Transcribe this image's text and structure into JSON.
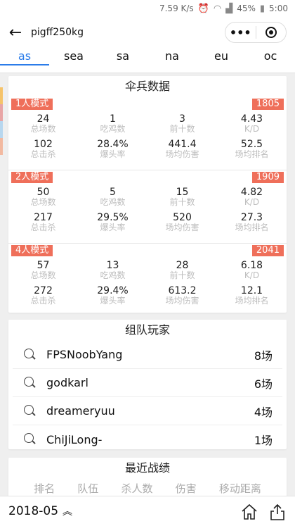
{
  "statusbar": {
    "speed": "7.59 K/s",
    "battery": "45%",
    "time": "5:00"
  },
  "navbar": {
    "title": "pigff250kg",
    "more_icon": "•••"
  },
  "tabs": [
    "as",
    "sea",
    "sa",
    "na",
    "eu",
    "oc"
  ],
  "side_tag_colors": [
    "#f5c36a",
    "#e8a5a5",
    "#b7d7ef",
    "#f2b9a0"
  ],
  "infantry": {
    "title": "伞兵数据",
    "labels": [
      "总场数",
      "吃鸡数",
      "前十数",
      "K/D",
      "总击杀",
      "爆头率",
      "场均伤害",
      "场均排名"
    ],
    "modes": [
      {
        "name": "1人模式",
        "rating": "1805",
        "values": [
          "24",
          "1",
          "3",
          "4.43",
          "102",
          "28.4%",
          "441.4",
          "52.5"
        ]
      },
      {
        "name": "2人模式",
        "rating": "1909",
        "values": [
          "50",
          "5",
          "15",
          "4.82",
          "217",
          "29.5%",
          "520",
          "27.3"
        ]
      },
      {
        "name": "4人模式",
        "rating": "2041",
        "values": [
          "57",
          "13",
          "28",
          "6.18",
          "272",
          "29.4%",
          "613.2",
          "12.1"
        ]
      }
    ]
  },
  "team": {
    "title": "组队玩家",
    "players": [
      {
        "name": "FPSNoobYang",
        "count": "8场"
      },
      {
        "name": "godkarl",
        "count": "6场"
      },
      {
        "name": "dreameryuu",
        "count": "4场"
      },
      {
        "name": "ChiJiLong-",
        "count": "1场"
      }
    ]
  },
  "recent": {
    "title": "最近战绩",
    "columns": [
      "排名",
      "队伍",
      "杀人数",
      "伤害",
      "移动距离"
    ]
  },
  "bottom": {
    "date": "2018-05"
  },
  "colors": {
    "accent": "#2b7ce9",
    "badge": "#ef6f5a"
  }
}
